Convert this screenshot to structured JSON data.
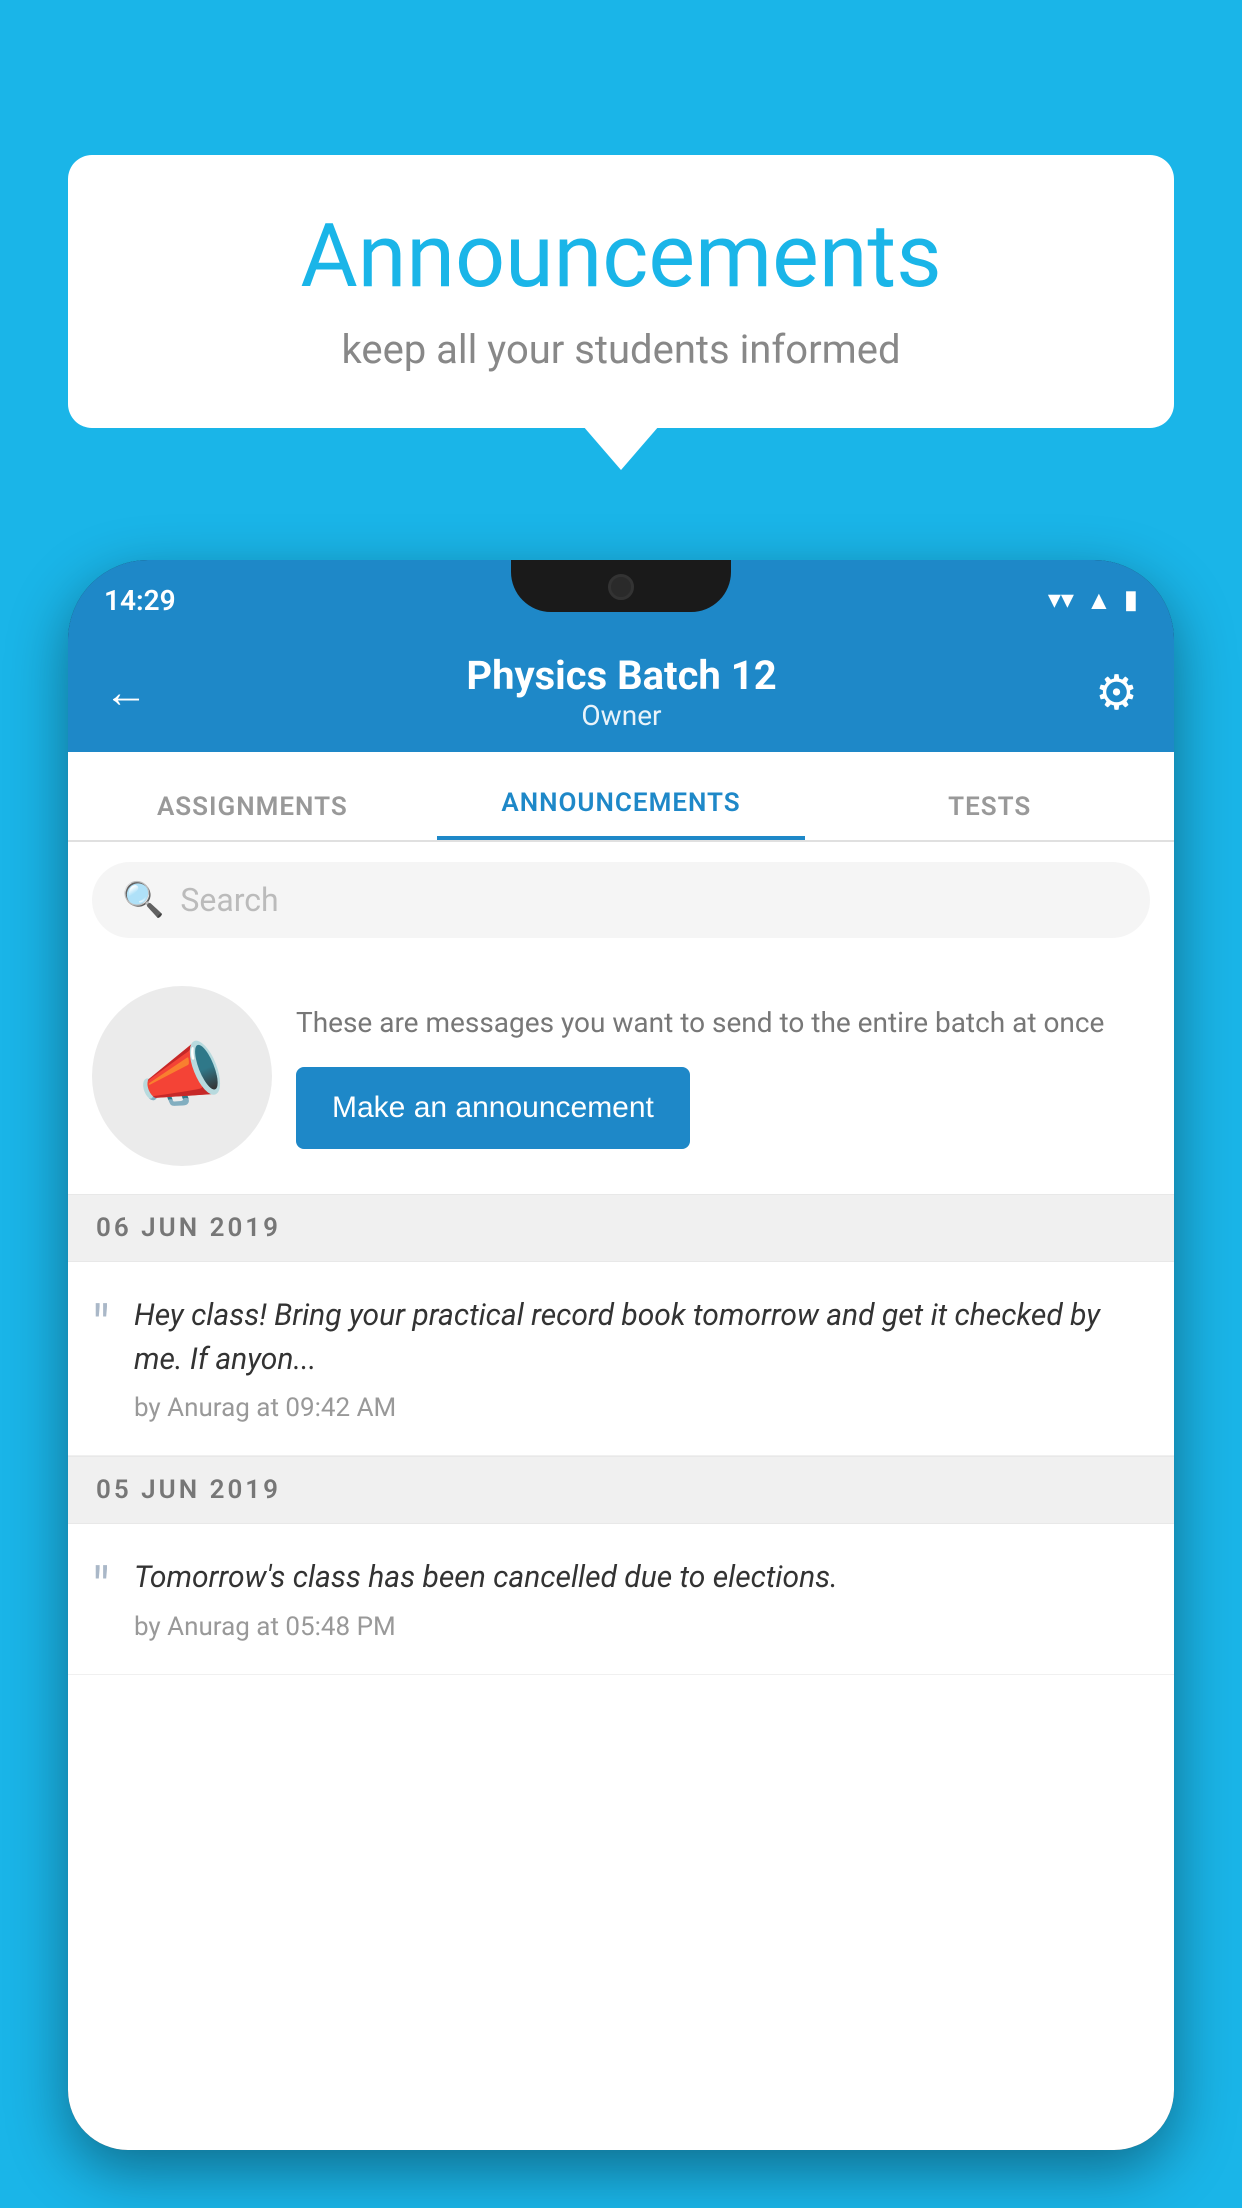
{
  "bubble": {
    "title": "Announcements",
    "subtitle": "keep all your students informed"
  },
  "phone": {
    "status_bar": {
      "time": "14:29"
    },
    "header": {
      "back_label": "←",
      "title": "Physics Batch 12",
      "subtitle": "Owner",
      "gear_label": "⚙"
    },
    "tabs": [
      {
        "label": "ASSIGNMENTS",
        "active": false
      },
      {
        "label": "ANNOUNCEMENTS",
        "active": true
      },
      {
        "label": "TESTS",
        "active": false
      }
    ],
    "search": {
      "placeholder": "Search"
    },
    "promo": {
      "text": "These are messages you want to send to the entire batch at once",
      "button_label": "Make an announcement"
    },
    "announcements": [
      {
        "date": "06  JUN  2019",
        "items": [
          {
            "text": "Hey class! Bring your practical record book tomorrow and get it checked by me. If anyon...",
            "meta": "by Anurag at 09:42 AM"
          }
        ]
      },
      {
        "date": "05  JUN  2019",
        "items": [
          {
            "text": "Tomorrow's class has been cancelled due to elections.",
            "meta": "by Anurag at 05:48 PM"
          }
        ]
      }
    ]
  },
  "colors": {
    "background": "#1ab5e8",
    "header": "#1e88c8",
    "button": "#1e88c8",
    "white": "#ffffff"
  }
}
